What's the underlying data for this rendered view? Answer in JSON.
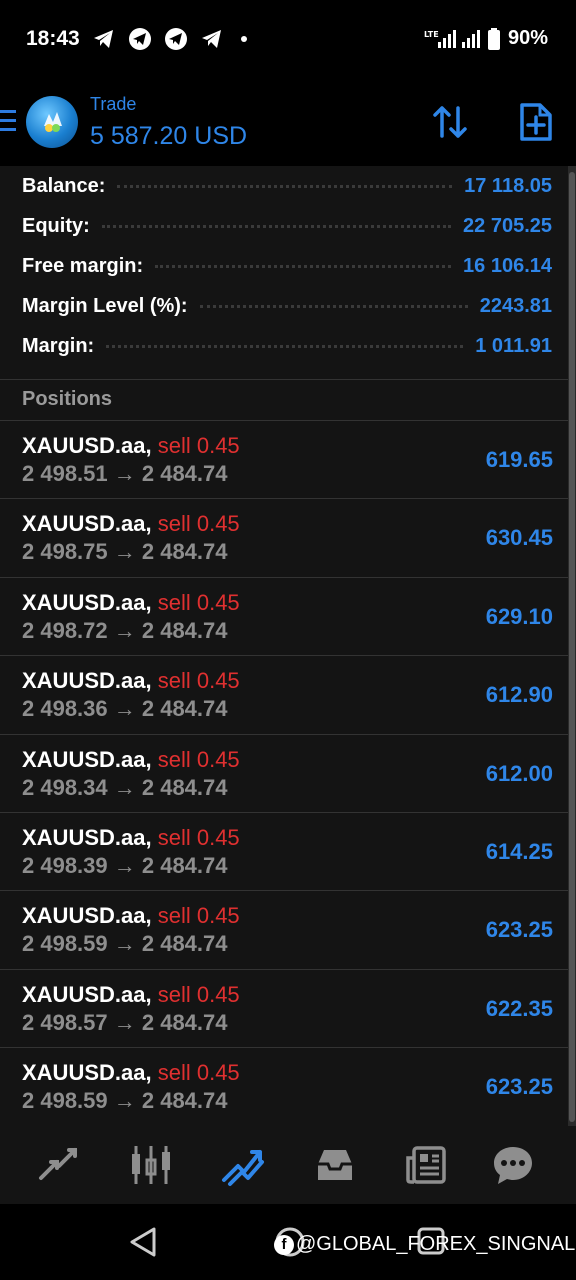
{
  "status_bar": {
    "time": "18:43",
    "battery": "90%",
    "network": "LTE"
  },
  "header": {
    "title": "Trade",
    "balance_display": "5 587.20 USD"
  },
  "summary": [
    {
      "label": "Balance:",
      "value": "17 118.05"
    },
    {
      "label": "Equity:",
      "value": "22 705.25"
    },
    {
      "label": "Free margin:",
      "value": "16 106.14"
    },
    {
      "label": "Margin Level (%):",
      "value": "2243.81"
    },
    {
      "label": "Margin:",
      "value": "1 011.91"
    }
  ],
  "positions_title": "Positions",
  "positions": [
    {
      "symbol": "XAUUSD.aa,",
      "side": "sell 0.45",
      "prices": "2 498.51 → 2 484.74",
      "profit": "619.65"
    },
    {
      "symbol": "XAUUSD.aa,",
      "side": "sell 0.45",
      "prices": "2 498.75 → 2 484.74",
      "profit": "630.45"
    },
    {
      "symbol": "XAUUSD.aa,",
      "side": "sell 0.45",
      "prices": "2 498.72 → 2 484.74",
      "profit": "629.10"
    },
    {
      "symbol": "XAUUSD.aa,",
      "side": "sell 0.45",
      "prices": "2 498.36 → 2 484.74",
      "profit": "612.90"
    },
    {
      "symbol": "XAUUSD.aa,",
      "side": "sell 0.45",
      "prices": "2 498.34 → 2 484.74",
      "profit": "612.00"
    },
    {
      "symbol": "XAUUSD.aa,",
      "side": "sell 0.45",
      "prices": "2 498.39 → 2 484.74",
      "profit": "614.25"
    },
    {
      "symbol": "XAUUSD.aa,",
      "side": "sell 0.45",
      "prices": "2 498.59 → 2 484.74",
      "profit": "623.25"
    },
    {
      "symbol": "XAUUSD.aa,",
      "side": "sell 0.45",
      "prices": "2 498.57 → 2 484.74",
      "profit": "622.35"
    },
    {
      "symbol": "XAUUSD.aa,",
      "side": "sell 0.45",
      "prices": "2 498.59 → 2 484.74",
      "profit": "623.25"
    }
  ],
  "bottom_nav": [
    {
      "icon": "quotes-icon",
      "active": false
    },
    {
      "icon": "chart-icon",
      "active": false
    },
    {
      "icon": "trade-icon",
      "active": true
    },
    {
      "icon": "history-icon",
      "active": false
    },
    {
      "icon": "news-icon",
      "active": false
    },
    {
      "icon": "messages-icon",
      "active": false
    }
  ],
  "watermark": "@GLOBAL_FOREX_SINGNALS",
  "colors": {
    "accent": "#2f86e8",
    "sell": "#e03030",
    "background": "#141414",
    "muted": "#8e8e8e"
  }
}
